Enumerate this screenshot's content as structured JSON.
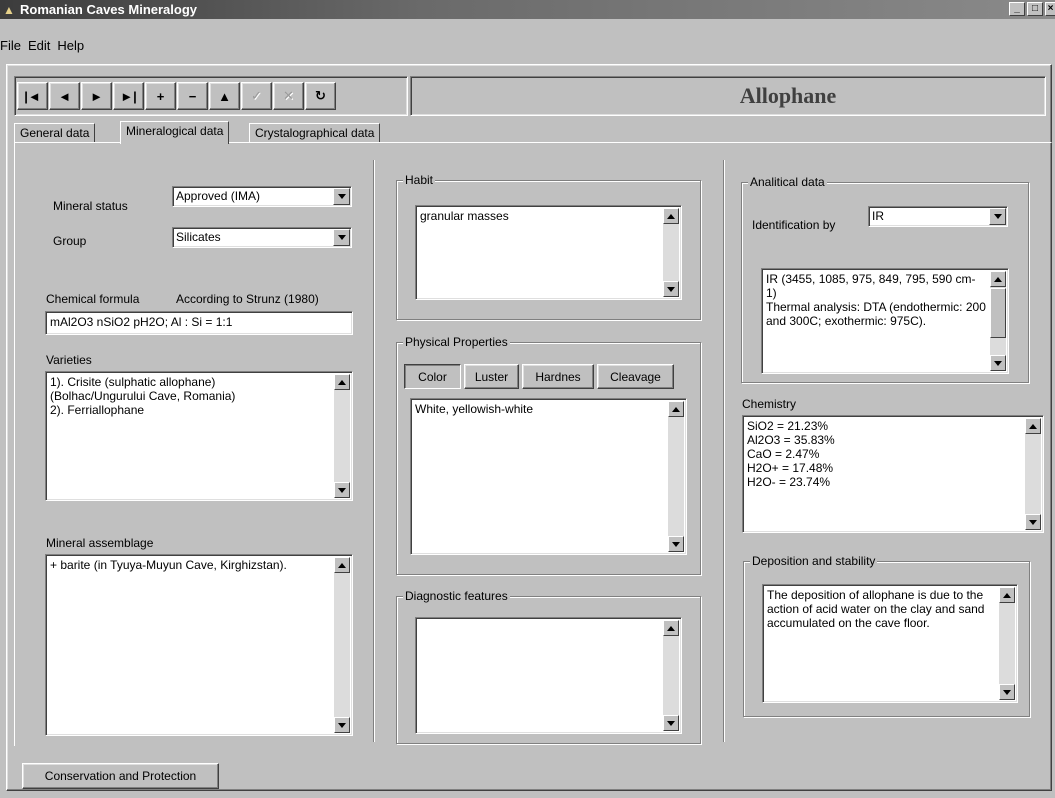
{
  "window": {
    "title": "Romanian Caves Mineralogy"
  },
  "menu": [
    "File",
    "Edit",
    "Help"
  ],
  "toolbar": {
    "buttons": [
      {
        "name": "first-record-button",
        "glyph": "|◄",
        "enabled": true
      },
      {
        "name": "prior-record-button",
        "glyph": "◄",
        "enabled": true
      },
      {
        "name": "next-record-button",
        "glyph": "►",
        "enabled": true
      },
      {
        "name": "last-record-button",
        "glyph": "►|",
        "enabled": true
      },
      {
        "name": "insert-record-button",
        "glyph": "+",
        "enabled": true
      },
      {
        "name": "delete-record-button",
        "glyph": "−",
        "enabled": true
      },
      {
        "name": "edit-record-button",
        "glyph": "▲",
        "enabled": true
      },
      {
        "name": "post-record-button",
        "glyph": "✓",
        "enabled": false
      },
      {
        "name": "cancel-record-button",
        "glyph": "✕",
        "enabled": false
      },
      {
        "name": "refresh-button",
        "glyph": "↻",
        "enabled": true
      }
    ],
    "record_title": "Allophane"
  },
  "tabs": [
    "General data",
    "Mineralogical data",
    "Crystalographical data"
  ],
  "active_tab": 1,
  "left": {
    "mineral_status_label": "Mineral status",
    "mineral_status_value": "Approved (IMA)",
    "group_label": "Group",
    "group_value": "Silicates",
    "formula_label": "Chemical formula",
    "formula_note": "According to Strunz (1980)",
    "formula_value": "mAl2O3 nSiO2 pH2O; Al : Si = 1:1",
    "varieties_label": "Varieties",
    "varieties_text": "1). Crisite (sulphatic allophane)\n(Bolhac/Ungurului Cave, Romania)\n2). Ferriallophane",
    "assemblage_label": "Mineral assemblage",
    "assemblage_text": "+ barite (in Tyuya-Muyun Cave, Kirghizstan)."
  },
  "middle": {
    "habit_label": "Habit",
    "habit_text": "granular masses",
    "physical_label": "Physical Properties",
    "physical_buttons": [
      "Color",
      "Luster",
      "Hardnes",
      "Cleavage"
    ],
    "physical_text": "White, yellowish-white",
    "diagnostic_label": "Diagnostic features",
    "diagnostic_text": ""
  },
  "right": {
    "analitical_label": "Analitical data",
    "identification_label": "Identification by",
    "identification_value": "IR",
    "analitical_text": "IR (3455, 1085, 975, 849, 795, 590 cm-1)\nThermal analysis: DTA (endothermic: 200 and 300C; exothermic: 975C).",
    "chemistry_label": "Chemistry",
    "chemistry_text": "SiO2 = 21.23%\nAl2O3 = 35.83%\nCaO = 2.47%\nH2O+ = 17.48%\nH2O- = 23.74%",
    "deposition_label": "Deposition and stability",
    "deposition_text": "The deposition of allophane is due to the action of acid water on the clay and sand accumulated on the cave floor."
  },
  "bottom": {
    "conservation_button": "Conservation and Protection"
  }
}
